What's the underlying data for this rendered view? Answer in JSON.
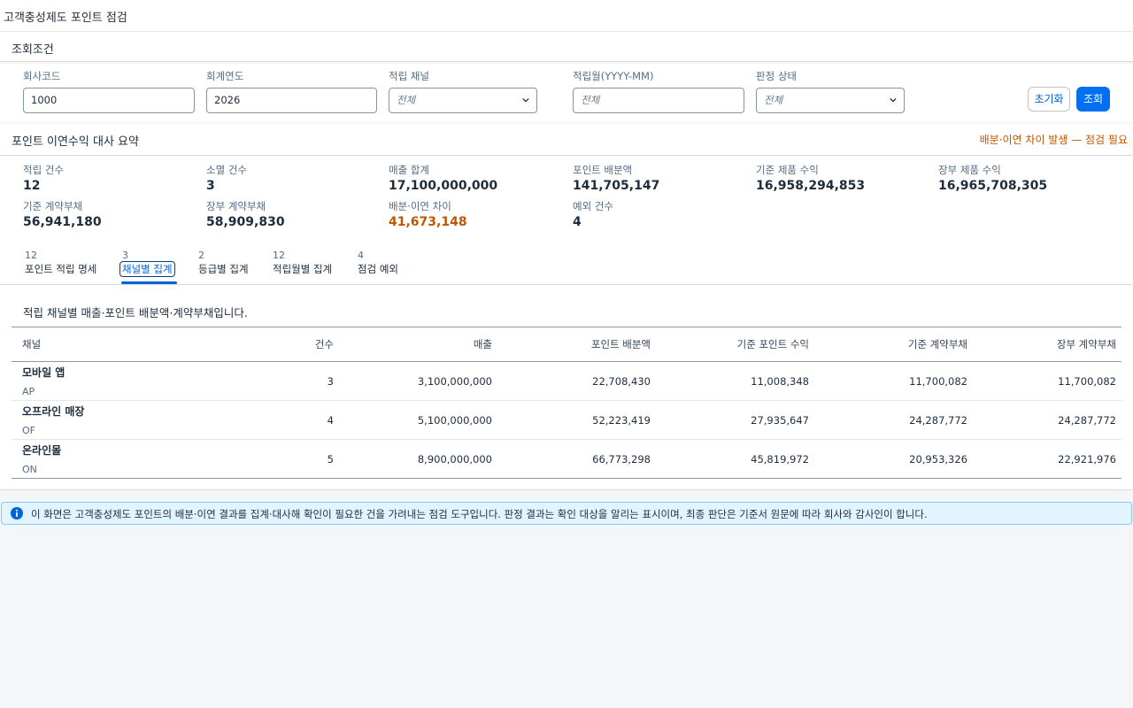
{
  "page": {
    "title": "고객충성제도 포인트 점검"
  },
  "filters": {
    "section_title": "조회조건",
    "company_code": {
      "label": "회사코드",
      "value": "1000"
    },
    "fiscal_year": {
      "label": "회계연도",
      "value": "2026"
    },
    "channel": {
      "label": "적립 채널",
      "value": "전체"
    },
    "month": {
      "label": "적립월(YYYY-MM)",
      "placeholder": "전체"
    },
    "status": {
      "label": "판정 상태",
      "value": "전체"
    },
    "reset_label": "초기화",
    "search_label": "조회"
  },
  "summary": {
    "section_title": "포인트 이연수익 대사 요약",
    "warning": "배분·이연 차이 발생 — 점검 필요",
    "kpis": [
      {
        "label": "적립 건수",
        "value": "12"
      },
      {
        "label": "소멸 건수",
        "value": "3"
      },
      {
        "label": "매출 합계",
        "value": "17,100,000,000"
      },
      {
        "label": "포인트 배분액",
        "value": "141,705,147"
      },
      {
        "label": "기준 제품 수익",
        "value": "16,958,294,853"
      },
      {
        "label": "장부 제품 수익",
        "value": "16,965,708,305"
      },
      {
        "label": "기준 계약부채",
        "value": "56,941,180"
      },
      {
        "label": "장부 계약부채",
        "value": "58,909,830"
      },
      {
        "label": "배분·이연 차이",
        "value": "41,673,148"
      },
      {
        "label": "예외 건수",
        "value": "4"
      }
    ]
  },
  "tabs": [
    {
      "count": "12",
      "label": "포인트 적립 명세"
    },
    {
      "count": "3",
      "label": "채널별 집계"
    },
    {
      "count": "2",
      "label": "등급별 집계"
    },
    {
      "count": "12",
      "label": "적립월별 집계"
    },
    {
      "count": "4",
      "label": "점검 예외"
    }
  ],
  "content": {
    "description": "적립 채널별 매출·포인트 배분액·계약부채입니다.",
    "columns": [
      "채널",
      "건수",
      "매출",
      "포인트 배분액",
      "기준 포인트 수익",
      "기준 계약부채",
      "장부 계약부채"
    ],
    "rows": [
      {
        "name": "모바일 앱",
        "code": "AP",
        "count": "3",
        "sales": "3,100,000,000",
        "allocation": "22,708,430",
        "point_revenue": "11,008,348",
        "std_liability": "11,700,082",
        "book_liability": "11,700,082"
      },
      {
        "name": "오프라인 매장",
        "code": "OF",
        "count": "4",
        "sales": "5,100,000,000",
        "allocation": "52,223,419",
        "point_revenue": "27,935,647",
        "std_liability": "24,287,772",
        "book_liability": "24,287,772"
      },
      {
        "name": "온라인몰",
        "code": "ON",
        "count": "5",
        "sales": "8,900,000,000",
        "allocation": "66,773,298",
        "point_revenue": "45,819,972",
        "std_liability": "20,953,326",
        "book_liability": "22,921,976"
      }
    ]
  },
  "info": {
    "text": "이 화면은 고객충성제도 포인트의 배분·이연 결과를 집계·대사해 확인이 필요한 건을 가려내는 점검 도구입니다. 판정 결과는 확인 대상을 알리는 표시이며, 최종 판단은 기준서 원문에 따라 회사와 감사인이 합니다."
  },
  "colors": {
    "accent": "#0070f2",
    "warning": "#c35500",
    "info_bg": "#e1f4ff"
  },
  "icons": {
    "dropdown": "chevron-down-icon",
    "info": "info-icon"
  }
}
